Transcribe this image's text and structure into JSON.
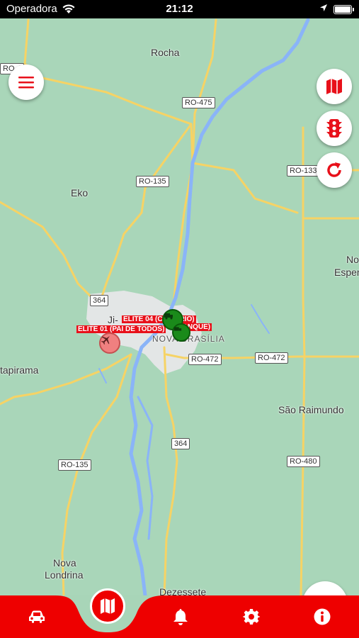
{
  "status_bar": {
    "carrier": "Operadora",
    "time": "21:12"
  },
  "map": {
    "places": [
      {
        "name": "Rocha"
      },
      {
        "name": "Eko"
      },
      {
        "name": "Ji-"
      },
      {
        "name": "NOVA BRASÍLIA"
      },
      {
        "name": "tapirama"
      },
      {
        "name": "São Raimundo"
      },
      {
        "name": "No"
      },
      {
        "name": "Esper"
      },
      {
        "name": "Nova"
      },
      {
        "name": "Londrina"
      },
      {
        "name": "Dezessete"
      }
    ],
    "road_shields": [
      {
        "label": "RO-4"
      },
      {
        "label": "RO-475"
      },
      {
        "label": "RO-133"
      },
      {
        "label": "RO-135"
      },
      {
        "label": "364"
      },
      {
        "label": "RO-472"
      },
      {
        "label": "RO-472"
      },
      {
        "label": "364"
      },
      {
        "label": "RO-135"
      },
      {
        "label": "RO-480"
      }
    ],
    "vehicles": [
      {
        "label": "ELITE 04 (CAMINHÃO USUÁRIO)",
        "visible": "ELITE 04 (C       USÁRIO)",
        "color": "#1a8a1a"
      },
      {
        "label": "ELITE 03 (TANQUE)",
        "visible": "(TANQUE)",
        "color": "#1a8a1a"
      },
      {
        "label": "ELITE 01 (PAI DE TODOS)",
        "visible": "ELITE 01 (PAI DE TODOS)",
        "color": "#f08080"
      }
    ]
  },
  "buttons": {
    "menu": "menu-icon",
    "map_type": "map-icon",
    "traffic": "traffic-light-icon",
    "refresh": "refresh-icon"
  },
  "tabbar": {
    "color": "#ee0000",
    "items": [
      {
        "icon": "car-icon",
        "active": false
      },
      {
        "icon": "map-icon",
        "active": true
      },
      {
        "icon": "bell-icon",
        "active": false
      },
      {
        "icon": "gear-icon",
        "active": false
      },
      {
        "icon": "info-icon",
        "active": false
      }
    ]
  }
}
